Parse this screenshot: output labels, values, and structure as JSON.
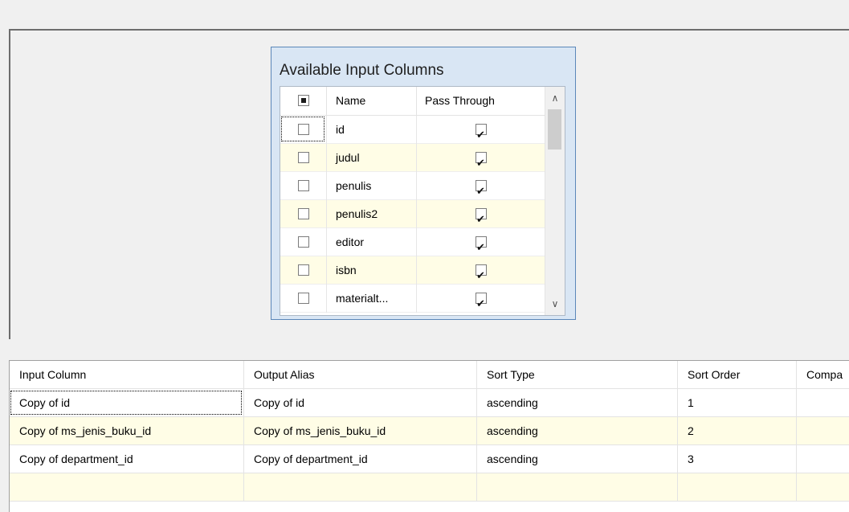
{
  "available_columns": {
    "title": "Available Input Columns",
    "headers": {
      "name": "Name",
      "pass_through": "Pass Through"
    },
    "select_all_state": "indeterminate",
    "rows": [
      {
        "name": "id",
        "selected": false,
        "pass_through": true
      },
      {
        "name": "judul",
        "selected": false,
        "pass_through": true
      },
      {
        "name": "penulis",
        "selected": false,
        "pass_through": true
      },
      {
        "name": "penulis2",
        "selected": false,
        "pass_through": true
      },
      {
        "name": "editor",
        "selected": false,
        "pass_through": true
      },
      {
        "name": "isbn",
        "selected": false,
        "pass_through": true
      },
      {
        "name": "materialt...",
        "selected": false,
        "pass_through": true
      }
    ],
    "scroll_icons": {
      "up": "chevron-up-icon",
      "down": "chevron-down-icon"
    }
  },
  "sort_grid": {
    "headers": [
      "Input Column",
      "Output Alias",
      "Sort Type",
      "Sort Order",
      "Compa"
    ],
    "rows": [
      {
        "input": "Copy of id",
        "alias": "Copy of id",
        "sort_type": "ascending",
        "sort_order": "1",
        "compare": ""
      },
      {
        "input": "Copy of ms_jenis_buku_id",
        "alias": "Copy of ms_jenis_buku_id",
        "sort_type": "ascending",
        "sort_order": "2",
        "compare": ""
      },
      {
        "input": "Copy of department_id",
        "alias": "Copy of department_id",
        "sort_type": "ascending",
        "sort_order": "3",
        "compare": ""
      },
      {
        "input": "",
        "alias": "",
        "sort_type": "",
        "sort_order": "",
        "compare": ""
      }
    ]
  },
  "colors": {
    "panel_bg": "#d9e6f4",
    "panel_border": "#5b87b9",
    "alt_row": "#fffde6",
    "window_bg": "#f0f0f0"
  }
}
